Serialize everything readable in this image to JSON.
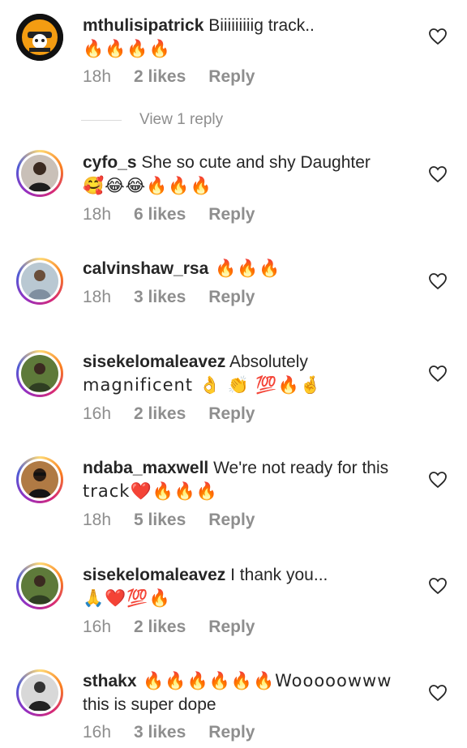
{
  "comments": [
    {
      "user": "mthulisipatrick",
      "text": " Biiiiiiiiig track..",
      "line2": "🔥🔥🔥🔥",
      "time": "18h",
      "likes": "2 likes",
      "reply": "Reply",
      "view_replies": "View 1 reply"
    },
    {
      "user": "cyfo_s",
      "text": " She so cute and shy Daughter",
      "line2": "🥰😂😂🔥🔥🔥",
      "time": "18h",
      "likes": "6 likes",
      "reply": "Reply"
    },
    {
      "user": "calvinshaw_rsa",
      "text": " 🔥🔥🔥",
      "time": "18h",
      "likes": "3 likes",
      "reply": "Reply"
    },
    {
      "user": "sisekelomaleavez",
      "text": " Absolutely",
      "line2": "magnificent 👌 👏 💯🔥🤞",
      "time": "16h",
      "likes": "2 likes",
      "reply": "Reply"
    },
    {
      "user": "ndaba_maxwell",
      "text": " We're not ready for this",
      "line2": "track❤️🔥🔥🔥",
      "time": "18h",
      "likes": "5 likes",
      "reply": "Reply"
    },
    {
      "user": "sisekelomaleavez",
      "text": " I thank you...",
      "line2": "🙏❤️💯🔥",
      "time": "16h",
      "likes": "2 likes",
      "reply": "Reply"
    },
    {
      "user": "sthakx",
      "text": " 🔥🔥🔥🔥🔥🔥Wooooowww",
      "line2": "this is super dope",
      "time": "16h",
      "likes": "3 likes",
      "reply": "Reply"
    }
  ],
  "colors": {
    "text": "#262626",
    "muted": "#8e8e8e"
  }
}
